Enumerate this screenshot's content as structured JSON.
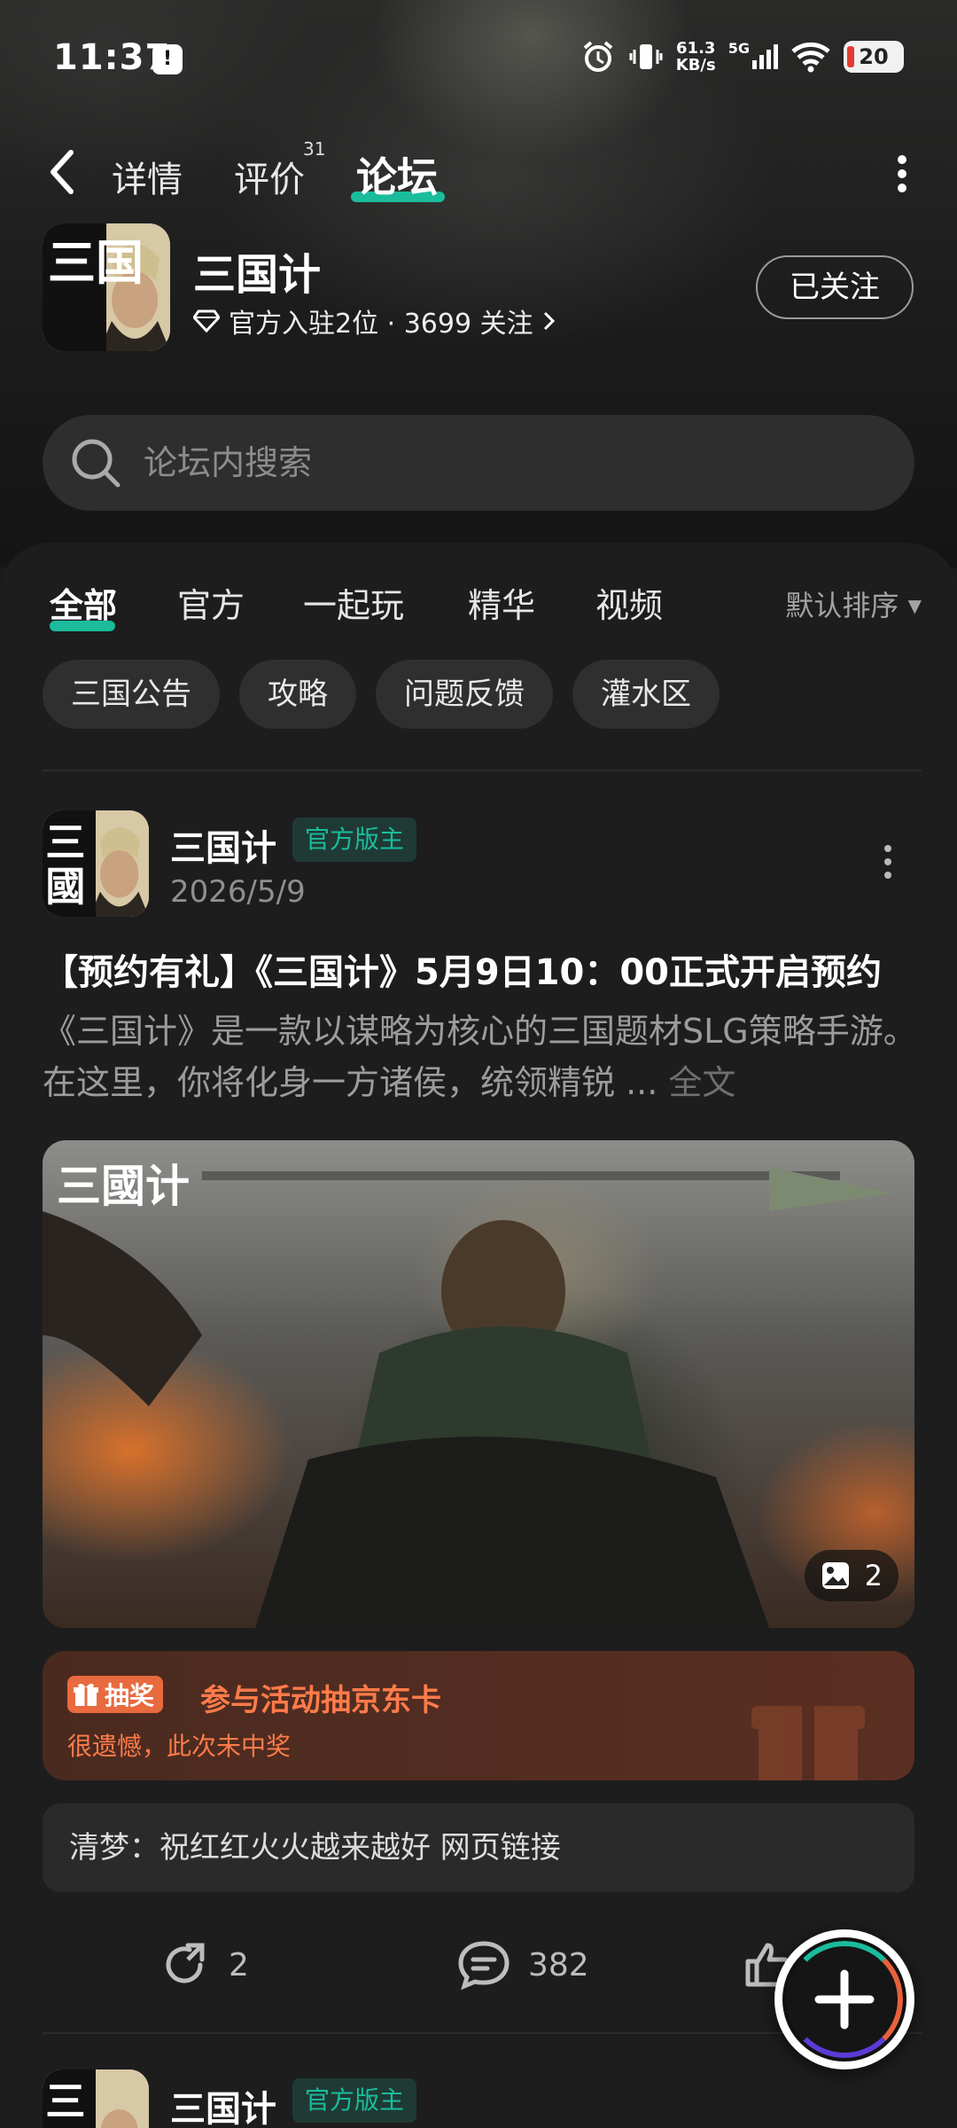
{
  "status_bar": {
    "time": "11:37",
    "network_speed": "61.3",
    "network_unit": "KB/s",
    "signal_label": "5G",
    "battery": "20"
  },
  "top_tabs": {
    "details": "详情",
    "reviews": "评价",
    "reviews_count": "31",
    "forum": "论坛"
  },
  "app": {
    "name": "三国计",
    "meta": "官方入驻2位 · 3699 关注",
    "follow_label": "已关注",
    "logo_text": "三国"
  },
  "search": {
    "placeholder": "论坛内搜索"
  },
  "categories": [
    {
      "label": "全部"
    },
    {
      "label": "官方"
    },
    {
      "label": "一起玩"
    },
    {
      "label": "精华"
    },
    {
      "label": "视频"
    }
  ],
  "sort_label": "默认排序",
  "chips": [
    {
      "label": "三国公告"
    },
    {
      "label": "攻略"
    },
    {
      "label": "问题反馈"
    },
    {
      "label": "灌水区"
    }
  ],
  "post": {
    "author": "三国计",
    "badge": "官方版主",
    "date": "2026/5/9",
    "title": "【预约有礼】《三国计》5月9日10：00正式开启预约",
    "body": "《三国计》是一款以谋略为核心的三国题材SLG策略手游。在这里，你将化身一方诸侯，统领精锐 ...",
    "full_text_label": "全文",
    "image_logo": "三國计",
    "image_count": "2",
    "lottery": {
      "tag": "抽奖",
      "title": "参与活动抽京东卡",
      "subtitle": "很遗憾，此次未中奖"
    },
    "comment_preview": "清梦：祝红红火火越来越好  网页链接",
    "shares": "2",
    "comments": "382"
  },
  "next_post": {
    "author": "三国计",
    "badge": "官方版主"
  },
  "colors": {
    "accent": "#1abc9c",
    "lottery_orange": "#ff7b4a",
    "background": "#1d1d1e"
  }
}
